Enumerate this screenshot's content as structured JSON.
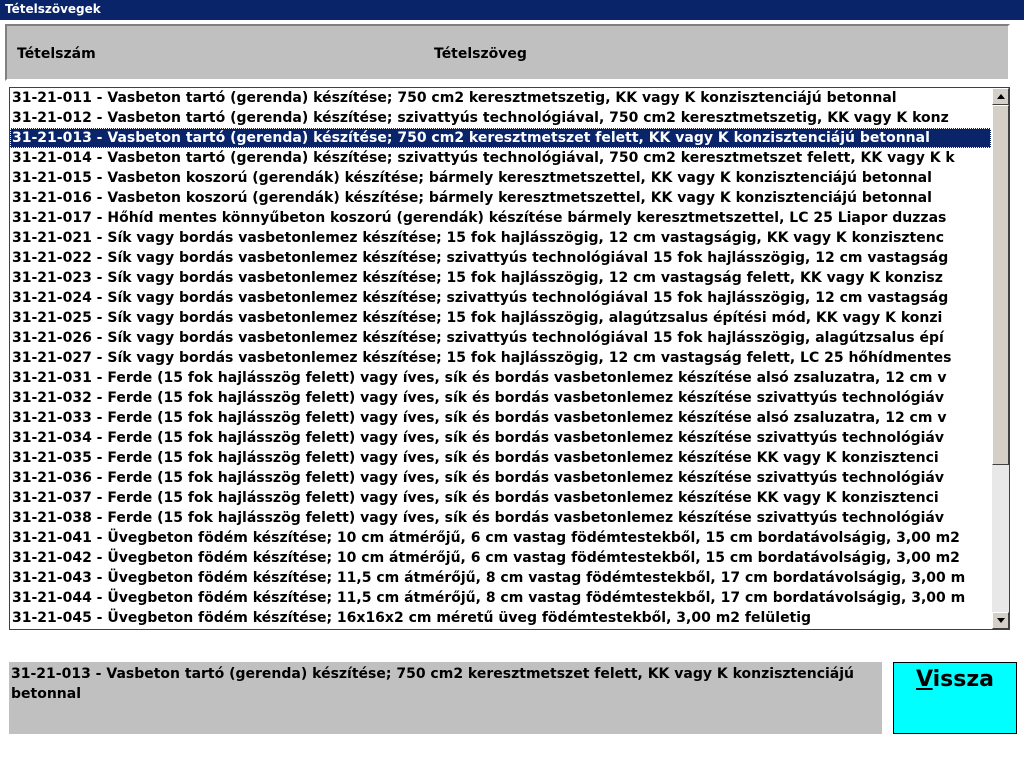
{
  "window": {
    "title": "Tételszövegek"
  },
  "header": {
    "col_number": "Tételszám",
    "col_text": "Tételszöveg"
  },
  "list": {
    "items": [
      "31-21-011 - Vasbeton tartó (gerenda) készítése; 750 cm2 keresztmetszetig, KK vagy K konzisztenciájú betonnal",
      "31-21-012 - Vasbeton tartó (gerenda) készítése; szivattyús technológiával, 750 cm2 keresztmetszetig, KK vagy K konz",
      "31-21-013 - Vasbeton tartó (gerenda) készítése; 750 cm2 keresztmetszet felett, KK vagy K konzisztenciájú betonnal",
      "31-21-014 - Vasbeton tartó (gerenda) készítése; szivattyús technológiával, 750 cm2 keresztmetszet felett, KK vagy K k",
      "31-21-015 - Vasbeton koszorú (gerendák) készítése; bármely keresztmetszettel, KK vagy K konzisztenciájú betonnal",
      "31-21-016 - Vasbeton koszorú (gerendák) készítése; bármely keresztmetszettel, KK vagy K konzisztenciájú betonnal",
      "31-21-017 - Hőhíd mentes könnyűbeton koszorú (gerendák) készítése bármely keresztmetszettel, LC 25 Liapor duzzas",
      "31-21-021 - Sík vagy bordás vasbetonlemez készítése; 15 fok hajlásszögig, 12 cm vastagságig, KK vagy K konzisztenc",
      "31-21-022 - Sík vagy bordás vasbetonlemez készítése; szivattyús technológiával 15 fok hajlásszögig, 12 cm vastagság",
      "31-21-023 - Sík vagy bordás vasbetonlemez készítése; 15 fok hajlásszögig, 12 cm vastagság felett, KK vagy K konzisz",
      "31-21-024 - Sík vagy bordás vasbetonlemez készítése; szivattyús technológiával 15 fok hajlásszögig, 12 cm vastagság",
      "31-21-025 - Sík vagy bordás vasbetonlemez készítése; 15 fok hajlásszögig, alagútzsalus építési mód, KK vagy K konzi",
      "31-21-026 - Sík vagy bordás vasbetonlemez készítése; szivattyús technológiával 15 fok hajlásszögig, alagútzsalus épí",
      "31-21-027 - Sík vagy bordás vasbetonlemez készítése; 15 fok hajlásszögig, 12 cm vastagság felett, LC 25 hőhídmentes",
      "31-21-031 - Ferde (15 fok hajlásszög felett) vagy íves, sík és bordás vasbetonlemez készítése alsó zsaluzatra, 12 cm v",
      "31-21-032 - Ferde (15 fok hajlásszög felett) vagy íves, sík és bordás vasbetonlemez készítése szivattyús technológiáv",
      "31-21-033 - Ferde (15 fok hajlásszög felett) vagy íves, sík és bordás vasbetonlemez készítése alsó zsaluzatra, 12 cm v",
      "31-21-034 - Ferde (15 fok hajlásszög felett) vagy íves, sík és bordás vasbetonlemez készítése szivattyús technológiáv",
      "31-21-035 - Ferde (15 fok hajlásszög felett) vagy íves, sík és bordás vasbetonlemez készítése KK vagy K konzisztenci",
      "31-21-036 - Ferde (15 fok hajlásszög felett) vagy íves, sík és bordás vasbetonlemez készítése szivattyús technológiáv",
      "31-21-037 - Ferde (15 fok hajlásszög felett) vagy íves, sík és bordás vasbetonlemez készítése KK vagy K konzisztenci",
      "31-21-038 - Ferde (15 fok hajlásszög felett) vagy íves, sík és bordás vasbetonlemez készítése szivattyús technológiáv",
      "31-21-041 - Üvegbeton födém készítése; 10 cm átmérőjű, 6 cm vastag födémtestekből, 15 cm bordatávolságig, 3,00 m2",
      "31-21-042 - Üvegbeton födém készítése; 10 cm átmérőjű, 6 cm vastag födémtestekből, 15 cm bordatávolságig, 3,00 m2",
      "31-21-043 - Üvegbeton födém készítése; 11,5 cm átmérőjű, 8 cm vastag födémtestekből, 17 cm bordatávolságig, 3,00 m",
      "31-21-044 - Üvegbeton födém készítése; 11,5 cm átmérőjű, 8 cm vastag födémtestekből, 17 cm bordatávolságig, 3,00 m",
      "31-21-045 - Üvegbeton födém készítése; 16x16x2 cm méretű üveg födémtestekből, 3,00 m2 felületig"
    ],
    "selected_index": 2
  },
  "detail": {
    "text": "31-21-013 - Vasbeton tartó (gerenda) készítése; 750 cm2 keresztmetszet felett, KK vagy K konzisztenciájú betonnal"
  },
  "back_button": {
    "accel": "V",
    "rest": "issza"
  },
  "colors": {
    "titlebar": "#0a246a",
    "selection": "#0a246a",
    "button": "#00ffff",
    "panel": "#c0c0c0"
  },
  "icons": {
    "scroll_up": "arrow-up-icon",
    "scroll_down": "arrow-down-icon"
  }
}
